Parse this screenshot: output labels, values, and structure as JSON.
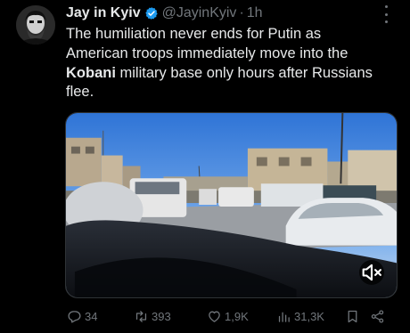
{
  "tweet": {
    "author_name": "Jay in Kyiv",
    "handle": "@JayinKyiv",
    "separator": "·",
    "time": "1h",
    "text_line1": "The humiliation never ends for Putin as",
    "text_line2": "American troops immediately move into the",
    "text_line3_bold": "Kobani",
    "text_line3_rest": " military base only hours after Russians",
    "text_line4": "flee."
  },
  "actions": {
    "replies": "34",
    "retweets": "393",
    "likes": "1,9K",
    "views": "31,3K"
  },
  "icons": {
    "verified": "verified-badge-icon",
    "more": "more-options-icon",
    "mute": "volume-muted-icon",
    "reply": "reply-icon",
    "retweet": "retweet-icon",
    "like": "heart-icon",
    "views": "views-bar-chart-icon",
    "bookmark": "bookmark-icon",
    "share": "share-icon"
  },
  "colors": {
    "background": "#000000",
    "text": "#e7e9ea",
    "muted": "#71767b",
    "verified": "#1d9bf0"
  }
}
